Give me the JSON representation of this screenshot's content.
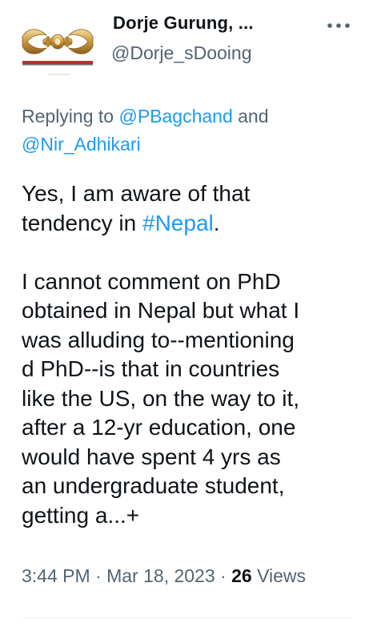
{
  "author": {
    "display_name": "Dorje Gurung, ...",
    "username": "@Dorje_sDooing",
    "avatar_icon": "vajra-icon"
  },
  "more_icon": "more-options-icon",
  "replying": {
    "prefix": "Replying to ",
    "mention_1": "@PBagchand",
    "conjunction": " and",
    "mention_2": "@Nir_Adhikari"
  },
  "body": {
    "line_1": "Yes, I am aware of that",
    "line_2_pre": "tendency in ",
    "line_2_hashtag": "#Nepal",
    "line_2_post": ".",
    "paragraph_2": [
      "I cannot comment on PhD",
      "obtained in Nepal but what I",
      "was alluding to--mentioning",
      "d PhD--is that in countries",
      "like the US, on the way to it,",
      "after a 12-yr education, one",
      "would have spent 4 yrs as",
      "an undergraduate student,",
      "getting a...+"
    ]
  },
  "meta": {
    "time": "3:44 PM",
    "separator": " · ",
    "date": "Mar 18, 2023",
    "views_count": "26",
    "views_label": "Views"
  },
  "colors": {
    "text": "#0f1419",
    "secondary": "#536471",
    "link": "#1d9bf0"
  }
}
